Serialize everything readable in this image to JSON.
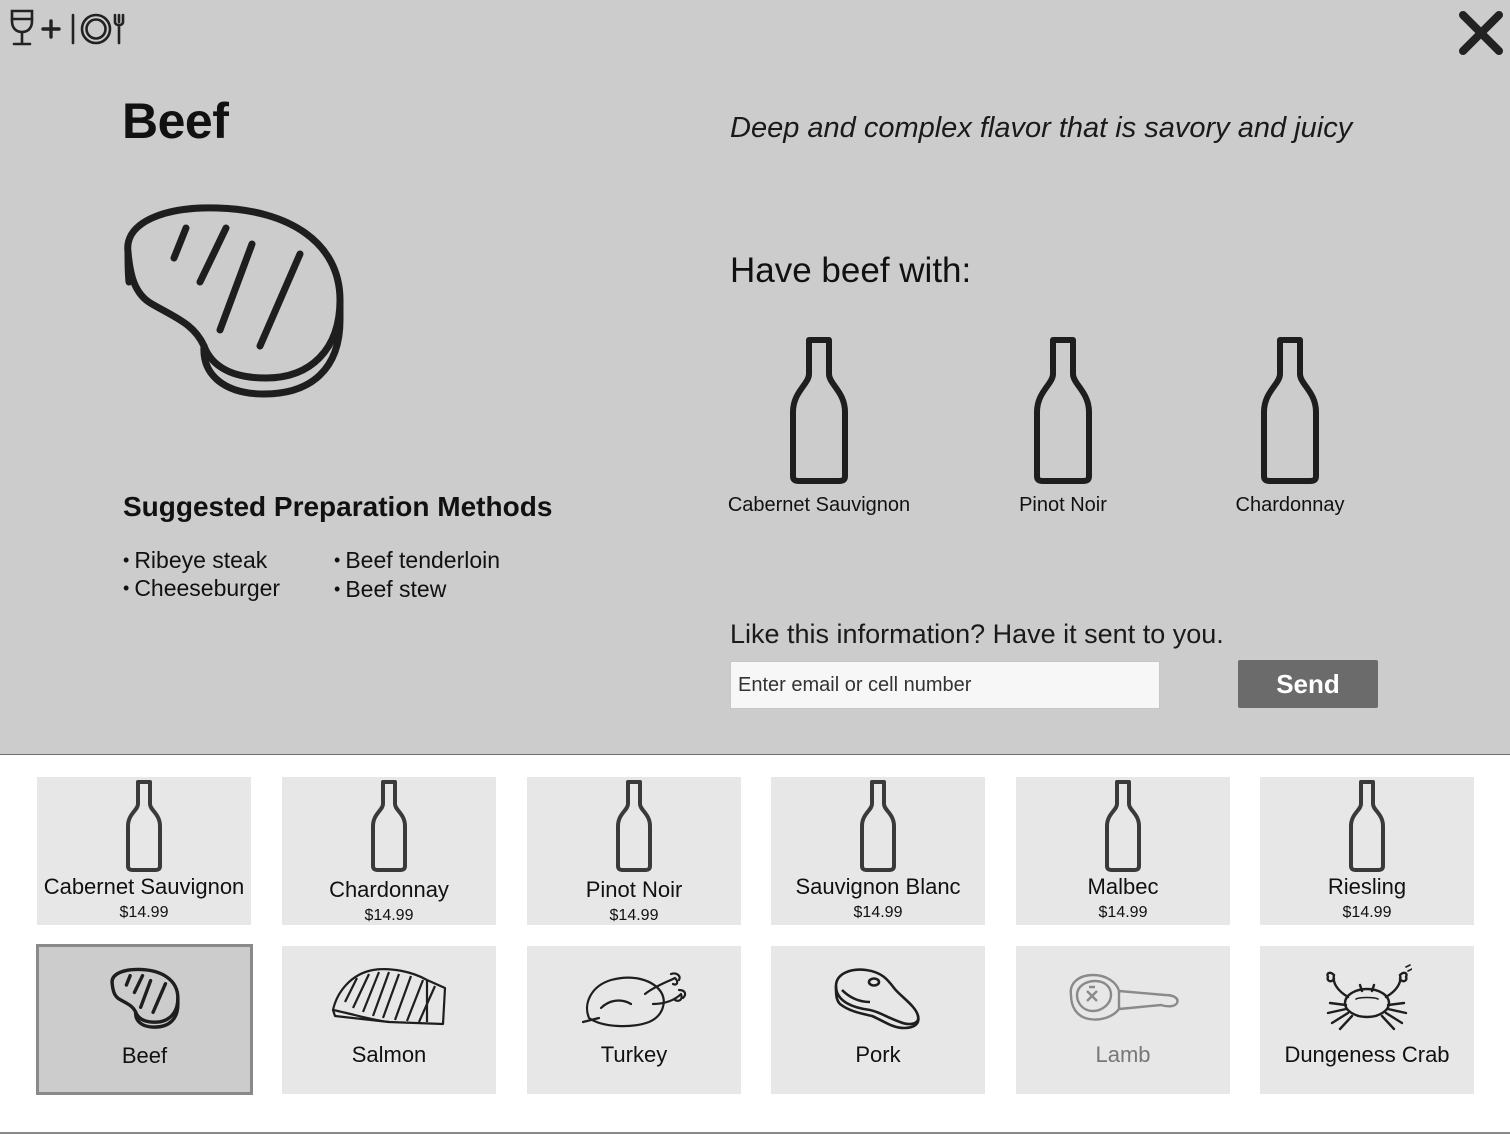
{
  "header": {
    "logo_icon": "wine-glass-plus-plate-icon",
    "close_icon": "close-icon"
  },
  "detail": {
    "title": "Beef",
    "dish_icon": "steak-icon",
    "description": "Deep and complex flavor that is savory and juicy",
    "pairing_heading": "Have beef with:",
    "pairings": [
      {
        "name": "Cabernet Sauvignon",
        "icon": "wine-bottle-icon"
      },
      {
        "name": "Pinot Noir",
        "icon": "wine-bottle-icon"
      },
      {
        "name": "Chardonnay",
        "icon": "wine-bottle-icon"
      }
    ],
    "prep_title": "Suggested Preparation Methods",
    "prep_methods": [
      "Ribeye steak",
      "Beef tenderloin",
      "Cheeseburger",
      "Beef stew"
    ],
    "send_prompt": "Like this information? Have it sent to you.",
    "email_placeholder": "Enter email or cell number",
    "send_label": "Send"
  },
  "wines": [
    {
      "name": "Cabernet Sauvignon",
      "price": "$14.99"
    },
    {
      "name": "Chardonnay",
      "price": "$14.99"
    },
    {
      "name": "Pinot Noir",
      "price": "$14.99"
    },
    {
      "name": "Sauvignon Blanc",
      "price": "$14.99"
    },
    {
      "name": "Malbec",
      "price": "$14.99"
    },
    {
      "name": "Riesling",
      "price": "$14.99"
    }
  ],
  "foods": [
    {
      "name": "Beef",
      "icon": "steak-icon",
      "selected": true
    },
    {
      "name": "Salmon",
      "icon": "salmon-fillet-icon"
    },
    {
      "name": "Turkey",
      "icon": "roast-turkey-icon"
    },
    {
      "name": "Pork",
      "icon": "pork-chop-icon"
    },
    {
      "name": "Lamb",
      "icon": "lamb-chop-icon",
      "dimmed": true
    },
    {
      "name": "Dungeness Crab",
      "icon": "crab-icon"
    }
  ],
  "colors": {
    "panel_bg": "#cccccc",
    "tile_bg": "#e6e7e6",
    "send_button": "#6b6b6b"
  }
}
